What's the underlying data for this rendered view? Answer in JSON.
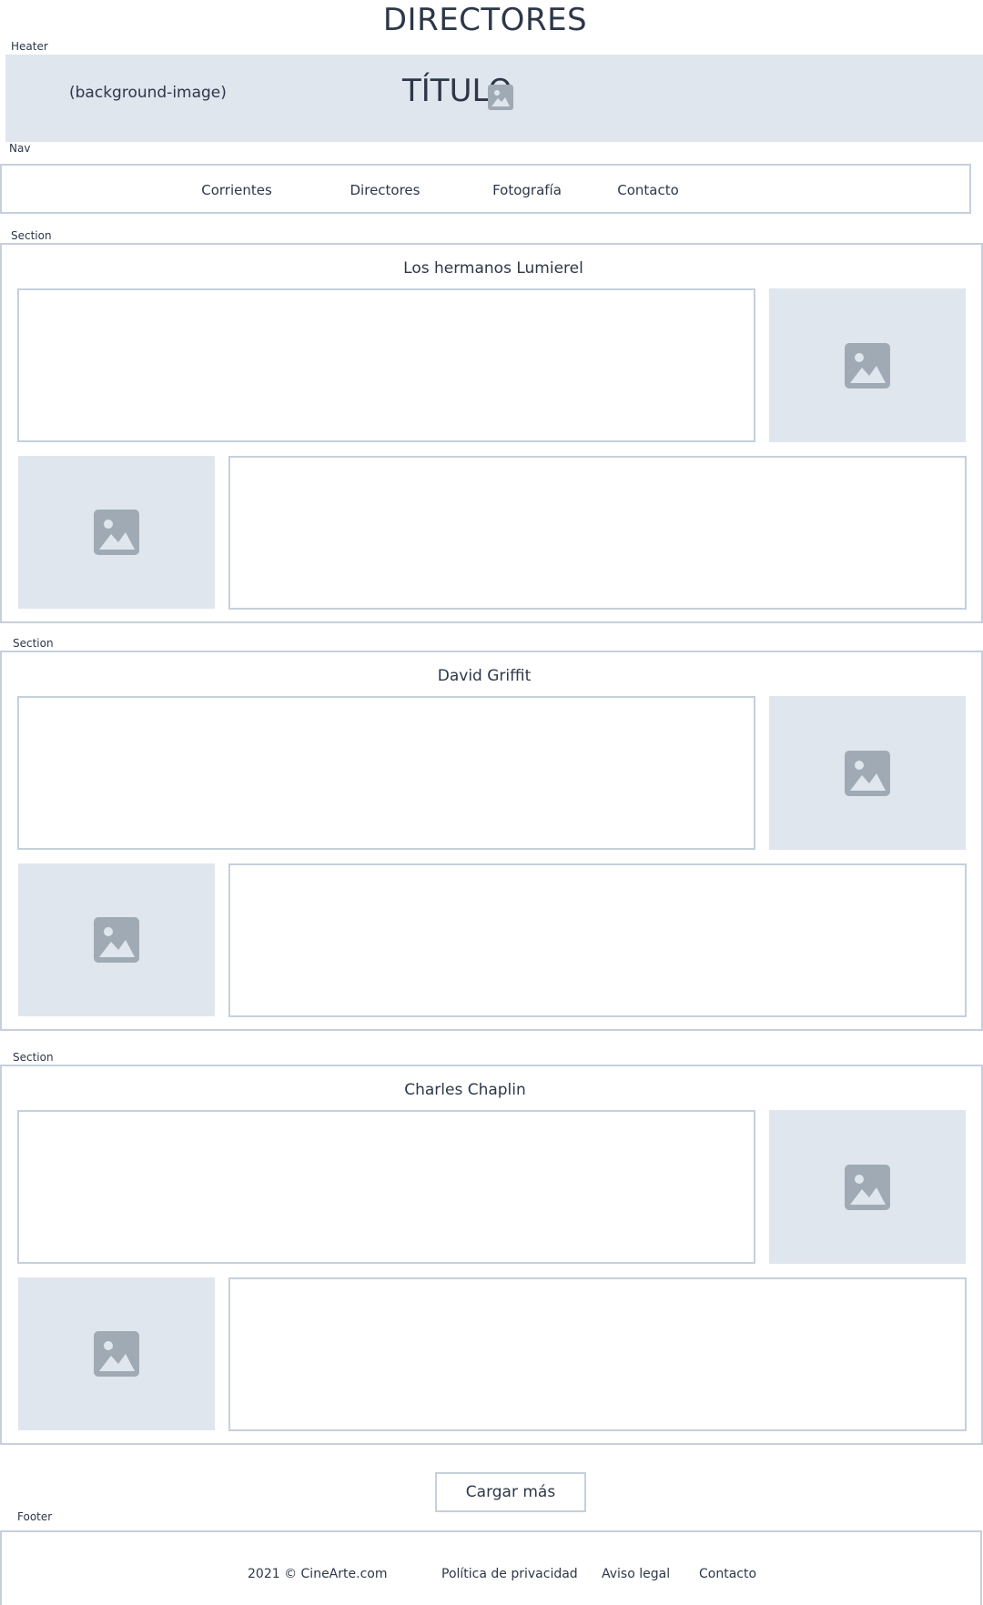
{
  "page": {
    "title": "DIRECTORES"
  },
  "header": {
    "tag": "Heater",
    "background_label": "(background-image)",
    "title": "TÍTULO",
    "image_icon": "image-icon"
  },
  "nav": {
    "tag": "Nav",
    "items": [
      {
        "label": "Corrientes"
      },
      {
        "label": "Directores"
      },
      {
        "label": "Fotografía"
      },
      {
        "label": "Contacto"
      }
    ]
  },
  "sections": [
    {
      "tag": "Section",
      "title": "Los hermanos Lumierel"
    },
    {
      "tag": "Section",
      "title": "David Griffit"
    },
    {
      "tag": "Section",
      "title": "Charles Chaplin"
    }
  ],
  "load_more": {
    "label": "Cargar más"
  },
  "footer": {
    "tag": "Footer",
    "copyright": "2021 © CineArte.com",
    "links": [
      {
        "label": "Política de privacidad"
      },
      {
        "label": "Aviso legal"
      },
      {
        "label": "Contacto"
      }
    ]
  },
  "colors": {
    "border": "#c5d0dc",
    "placeholder_bg": "#e0e6ee",
    "placeholder_icon": "#a0aab4",
    "text": "#2d3748"
  }
}
